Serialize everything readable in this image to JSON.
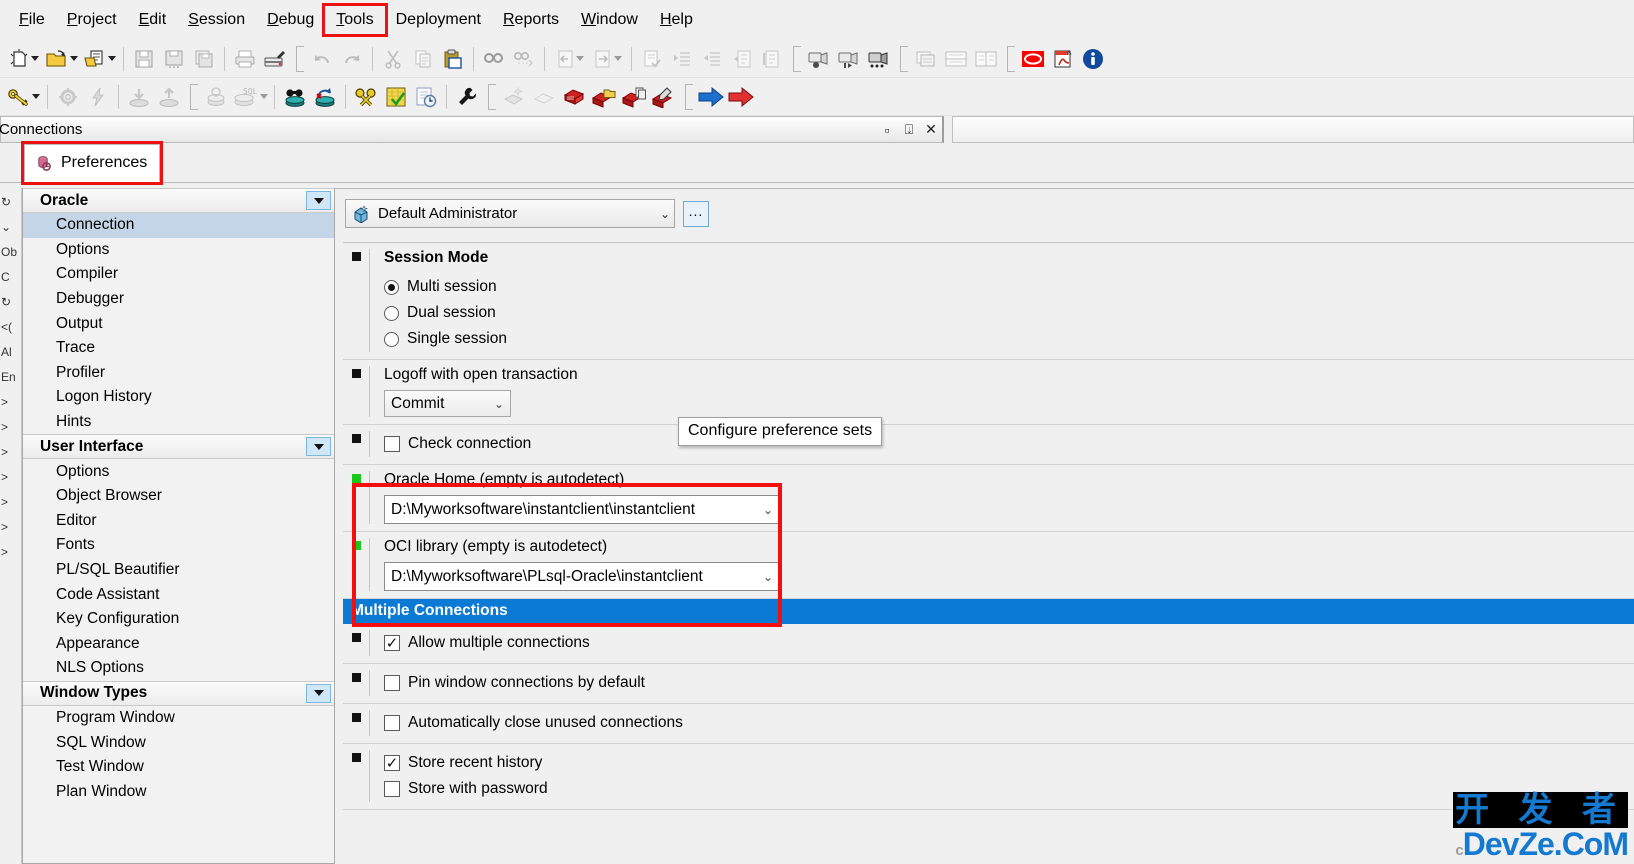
{
  "app": {
    "dock_title": "Connections"
  },
  "menubar": {
    "items": [
      {
        "label": "File",
        "mnemonic": "F",
        "highlight": false
      },
      {
        "label": "Project",
        "mnemonic": "P",
        "highlight": false
      },
      {
        "label": "Edit",
        "mnemonic": "E",
        "highlight": false
      },
      {
        "label": "Session",
        "mnemonic": "S",
        "highlight": false
      },
      {
        "label": "Debug",
        "mnemonic": "D",
        "highlight": false
      },
      {
        "label": "Tools",
        "mnemonic": "T",
        "highlight": true
      },
      {
        "label": "Deployment",
        "mnemonic": "",
        "highlight": false
      },
      {
        "label": "Reports",
        "mnemonic": "R",
        "highlight": false
      },
      {
        "label": "Window",
        "mnemonic": "W",
        "highlight": false
      },
      {
        "label": "Help",
        "mnemonic": "H",
        "highlight": false
      }
    ]
  },
  "dock": {
    "buttons": [
      "maximize-icon",
      "pin-icon",
      "close-icon"
    ]
  },
  "tab": {
    "label": "Preferences",
    "icon": "preferences-icon",
    "highlighted": true
  },
  "hidden_tree": {
    "fragments": [
      "↻",
      "⌄",
      "Ob",
      "C",
      "↻",
      "<(",
      "Al",
      "En",
      ">",
      ">",
      ">",
      ">",
      ">",
      ">",
      ">"
    ]
  },
  "categories": [
    {
      "group": "Oracle",
      "collapse_icon": "chevron-down-icon",
      "items": [
        {
          "label": "Connection",
          "selected": true
        },
        {
          "label": "Options",
          "selected": false
        },
        {
          "label": "Compiler",
          "selected": false
        },
        {
          "label": "Debugger",
          "selected": false
        },
        {
          "label": "Output",
          "selected": false
        },
        {
          "label": "Trace",
          "selected": false
        },
        {
          "label": "Profiler",
          "selected": false
        },
        {
          "label": "Logon History",
          "selected": false
        },
        {
          "label": "Hints",
          "selected": false
        }
      ]
    },
    {
      "group": "User Interface",
      "collapse_icon": "chevron-down-icon",
      "items": [
        {
          "label": "Options",
          "selected": false
        },
        {
          "label": "Object Browser",
          "selected": false
        },
        {
          "label": "Editor",
          "selected": false
        },
        {
          "label": "Fonts",
          "selected": false
        },
        {
          "label": "PL/SQL Beautifier",
          "selected": false
        },
        {
          "label": "Code Assistant",
          "selected": false
        },
        {
          "label": "Key Configuration",
          "selected": false
        },
        {
          "label": "Appearance",
          "selected": false
        },
        {
          "label": "NLS Options",
          "selected": false
        }
      ]
    },
    {
      "group": "Window Types",
      "collapse_icon": "chevron-down-icon",
      "items": [
        {
          "label": "Program Window",
          "selected": false
        },
        {
          "label": "SQL Window",
          "selected": false
        },
        {
          "label": "Test Window",
          "selected": false
        },
        {
          "label": "Plan Window",
          "selected": false
        }
      ]
    }
  ],
  "preference_set": {
    "value": "Default Administrator",
    "icon": "administrator-icon",
    "ellipsis_label": "...",
    "tooltip": "Configure preference sets"
  },
  "session_mode": {
    "title": "Session Mode",
    "options": [
      {
        "label": "Multi session",
        "checked": true
      },
      {
        "label": "Dual session",
        "checked": false
      },
      {
        "label": "Single session",
        "checked": false
      }
    ]
  },
  "logoff": {
    "label": "Logoff with open transaction",
    "value": "Commit"
  },
  "check_connection": {
    "label": "Check connection",
    "checked": false
  },
  "oracle_home": {
    "label": "Oracle Home (empty is autodetect)",
    "value": "D:\\Myworksoftware\\instantclient\\instantclient",
    "highlighted": true
  },
  "oci_library": {
    "label": "OCI library (empty is autodetect)",
    "value": "D:\\Myworksoftware\\PLsql-Oracle\\instantclient",
    "highlighted": true
  },
  "multiple_connections": {
    "section_title": "Multiple Connections",
    "options": [
      {
        "label": "Allow multiple connections",
        "checked": true
      },
      {
        "label": "Pin window connections by default",
        "checked": false
      },
      {
        "label": "Automatically close unused connections",
        "checked": false
      },
      {
        "label": "Store recent history",
        "checked": true
      },
      {
        "label": "Store with password",
        "checked": false
      }
    ]
  },
  "watermark": {
    "cn": "开 发 者",
    "prefix": "c",
    "en": "DevZe.CoM"
  },
  "colors": {
    "annotation": "#f40f0f",
    "section_bar": "#0a7ad4",
    "selection": "#c3d5e6",
    "green_marker": "#19c819"
  }
}
